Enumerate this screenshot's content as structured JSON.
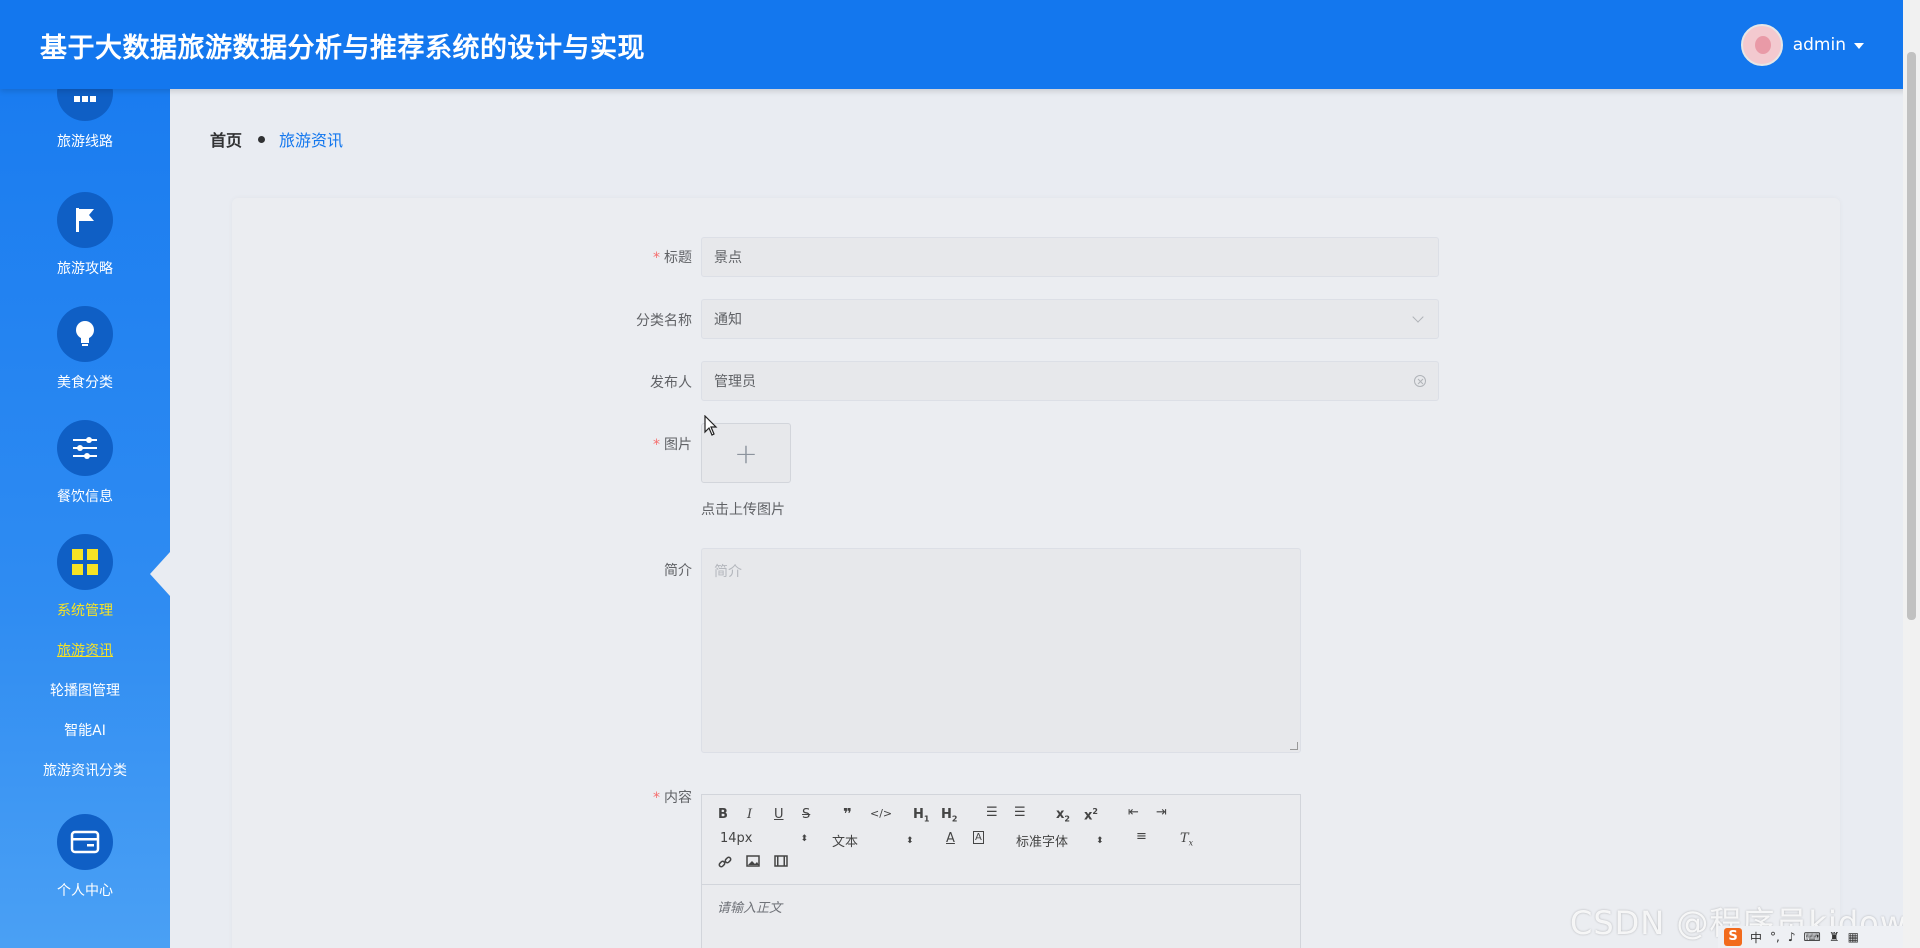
{
  "header": {
    "title": "基于大数据旅游数据分析与推荐系统的设计与实现",
    "username": "admin"
  },
  "sidebar": {
    "items": [
      {
        "label": "旅游线路",
        "icon": "grid-dots-icon"
      },
      {
        "label": "旅游攻略",
        "icon": "flag-icon"
      },
      {
        "label": "美食分类",
        "icon": "lightbulb-icon"
      },
      {
        "label": "餐饮信息",
        "icon": "sliders-icon"
      },
      {
        "label": "系统管理",
        "icon": "apps-grid-icon",
        "active": true
      },
      {
        "label": "个人中心",
        "icon": "card-icon"
      }
    ],
    "sub_items": [
      {
        "label": "旅游资讯",
        "active": true
      },
      {
        "label": "轮播图管理"
      },
      {
        "label": "智能AI"
      },
      {
        "label": "旅游资讯分类"
      }
    ]
  },
  "breadcrumb": {
    "home": "首页",
    "current": "旅游资讯"
  },
  "form": {
    "title": {
      "label": "标题",
      "required": true,
      "value": "景点"
    },
    "category": {
      "label": "分类名称",
      "value": "通知"
    },
    "publisher": {
      "label": "发布人",
      "value": "管理员"
    },
    "image": {
      "label": "图片",
      "required": true,
      "upload_icon": "+",
      "tip": "点击上传图片"
    },
    "intro": {
      "label": "简介",
      "placeholder": "简介"
    },
    "content": {
      "label": "内容",
      "required": true,
      "toolbar": {
        "font_size": "14px",
        "heading": "文本",
        "font_family": "标准字体",
        "h1": "H1",
        "h2": "H2"
      },
      "placeholder": "请输入正文"
    }
  },
  "watermark": "CSDN @程序员kidow",
  "colors": {
    "primary": "#1377ee",
    "active_menu": "#f7e324",
    "required": "#f56c6c"
  }
}
